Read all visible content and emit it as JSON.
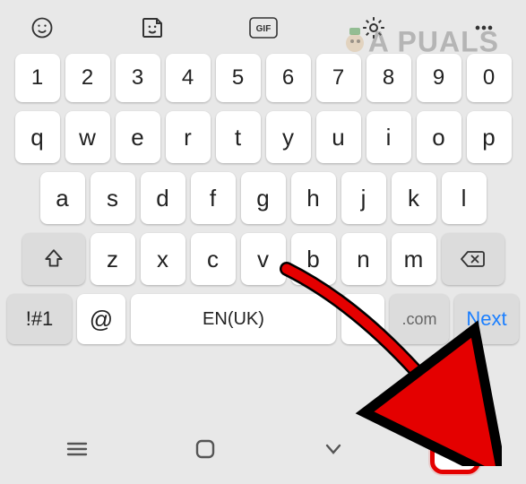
{
  "watermark": "A  PUALS",
  "rows": {
    "num": [
      "1",
      "2",
      "3",
      "4",
      "5",
      "6",
      "7",
      "8",
      "9",
      "0"
    ],
    "top": [
      "q",
      "w",
      "e",
      "r",
      "t",
      "y",
      "u",
      "i",
      "o",
      "p"
    ],
    "mid": [
      "a",
      "s",
      "d",
      "f",
      "g",
      "h",
      "j",
      "k",
      "l"
    ],
    "bot": [
      "z",
      "x",
      "c",
      "v",
      "b",
      "n",
      "m"
    ]
  },
  "symKey": "!#1",
  "atKey": "@",
  "spaceLabel": "EN(UK)",
  "dotKey": ".",
  "comKey": ".com",
  "nextKey": "Next"
}
